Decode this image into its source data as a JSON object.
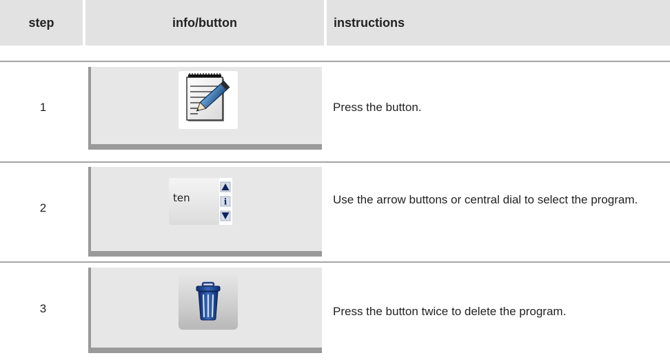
{
  "header": {
    "step": "step",
    "info": "info/button",
    "instructions": "instructions"
  },
  "rows": [
    {
      "step": "1",
      "icon": "notepad-pencil-icon",
      "instruction": "Press the button."
    },
    {
      "step": "2",
      "icon": "program-selector",
      "selector_value": "ten",
      "selector_info": "i",
      "instruction": "Use the arrow buttons or central dial to select the program."
    },
    {
      "step": "3",
      "icon": "trash-can-icon",
      "instruction": "Press the button twice to delete the program."
    }
  ],
  "colors": {
    "header_bg": "#e2e2e2",
    "panel_bg": "#e7e7e8",
    "panel_shadow": "#9a9a9a",
    "separator": "#a5a5a5",
    "trash_blue": "#1f3f8a"
  }
}
